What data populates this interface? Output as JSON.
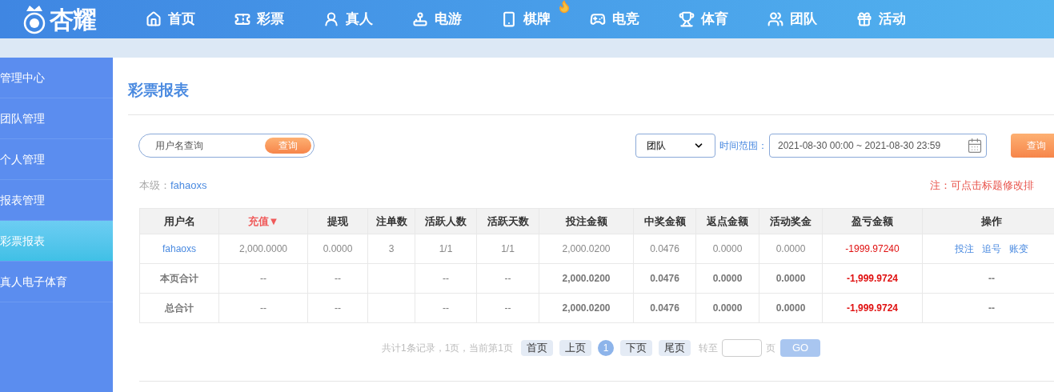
{
  "header": {
    "logo": "杏耀",
    "nav": [
      {
        "label": "首页",
        "hot": false
      },
      {
        "label": "彩票",
        "hot": false
      },
      {
        "label": "真人",
        "hot": false
      },
      {
        "label": "电游",
        "hot": false
      },
      {
        "label": "棋牌",
        "hot": true
      },
      {
        "label": "电竞",
        "hot": false
      },
      {
        "label": "体育",
        "hot": false
      },
      {
        "label": "团队",
        "hot": false
      },
      {
        "label": "活动",
        "hot": false
      }
    ]
  },
  "sidebar": {
    "items": [
      {
        "label": "管理中心",
        "selected": false
      },
      {
        "label": "团队管理",
        "selected": false
      },
      {
        "label": "个人管理",
        "selected": false
      },
      {
        "label": "报表管理",
        "selected": false
      },
      {
        "label": "彩票报表",
        "selected": true
      },
      {
        "label": "真人电子体育",
        "selected": false
      }
    ]
  },
  "page_title": "彩票报表",
  "filters": {
    "search": {
      "placeholder": "用户名查询",
      "button": "查询"
    },
    "scope": "团队",
    "range_label": "时间范围：",
    "range": "2021-08-30 00:00 ~ 2021-08-30 23:59",
    "query_button": "查询"
  },
  "level": {
    "label": "本级：",
    "user": "fahaoxs"
  },
  "note": "注：可点击标题修改排",
  "table": {
    "columns": [
      {
        "label": "用户名",
        "active": false,
        "kind": "user"
      },
      {
        "label": "充值▼",
        "active": true,
        "kind": "num"
      },
      {
        "label": "提现",
        "active": false,
        "kind": "num"
      },
      {
        "label": "注单数",
        "active": false,
        "kind": "num"
      },
      {
        "label": "活跃人数",
        "active": false,
        "kind": "num"
      },
      {
        "label": "活跃天数",
        "active": false,
        "kind": "num"
      },
      {
        "label": "投注金额",
        "active": false,
        "kind": "num"
      },
      {
        "label": "中奖金额",
        "active": false,
        "kind": "num"
      },
      {
        "label": "返点金额",
        "active": false,
        "kind": "num"
      },
      {
        "label": "活动奖金",
        "active": false,
        "kind": "num"
      },
      {
        "label": "盈亏金额",
        "active": false,
        "kind": "profit"
      },
      {
        "label": "操作",
        "active": false,
        "kind": "actions"
      }
    ],
    "rows": [
      {
        "kind": "data",
        "cells": [
          "fahaoxs",
          "2,000.0000",
          "0.0000",
          "3",
          "1/1",
          "1/1",
          "2,000.0200",
          "0.0476",
          "0.0000",
          "0.0000",
          "-1999.97240",
          [
            "投注",
            "追号",
            "账变"
          ]
        ]
      },
      {
        "kind": "total",
        "cells": [
          "本页合计",
          "--",
          "--",
          null,
          "--",
          "--",
          "2,000.0200",
          "0.0476",
          "0.0000",
          "0.0000",
          "-1,999.9724",
          "--"
        ]
      },
      {
        "kind": "total",
        "cells": [
          "总合计",
          "--",
          "--",
          null,
          "--",
          "--",
          "2,000.0200",
          "0.0476",
          "0.0000",
          "0.0000",
          "-1,999.9724",
          "--"
        ]
      }
    ]
  },
  "pagination": {
    "summary": "共计1条记录，1页，当前第1页",
    "items": [
      {
        "label": "首页",
        "kind": "button",
        "selected": false
      },
      {
        "label": "上页",
        "kind": "button",
        "selected": false
      },
      {
        "label": "1",
        "kind": "page",
        "selected": true
      },
      {
        "label": "下页",
        "kind": "button",
        "selected": false
      },
      {
        "label": "尾页",
        "kind": "button",
        "selected": false
      }
    ],
    "goto_label": "转至",
    "page_unit": "页",
    "go_button": "GO"
  }
}
